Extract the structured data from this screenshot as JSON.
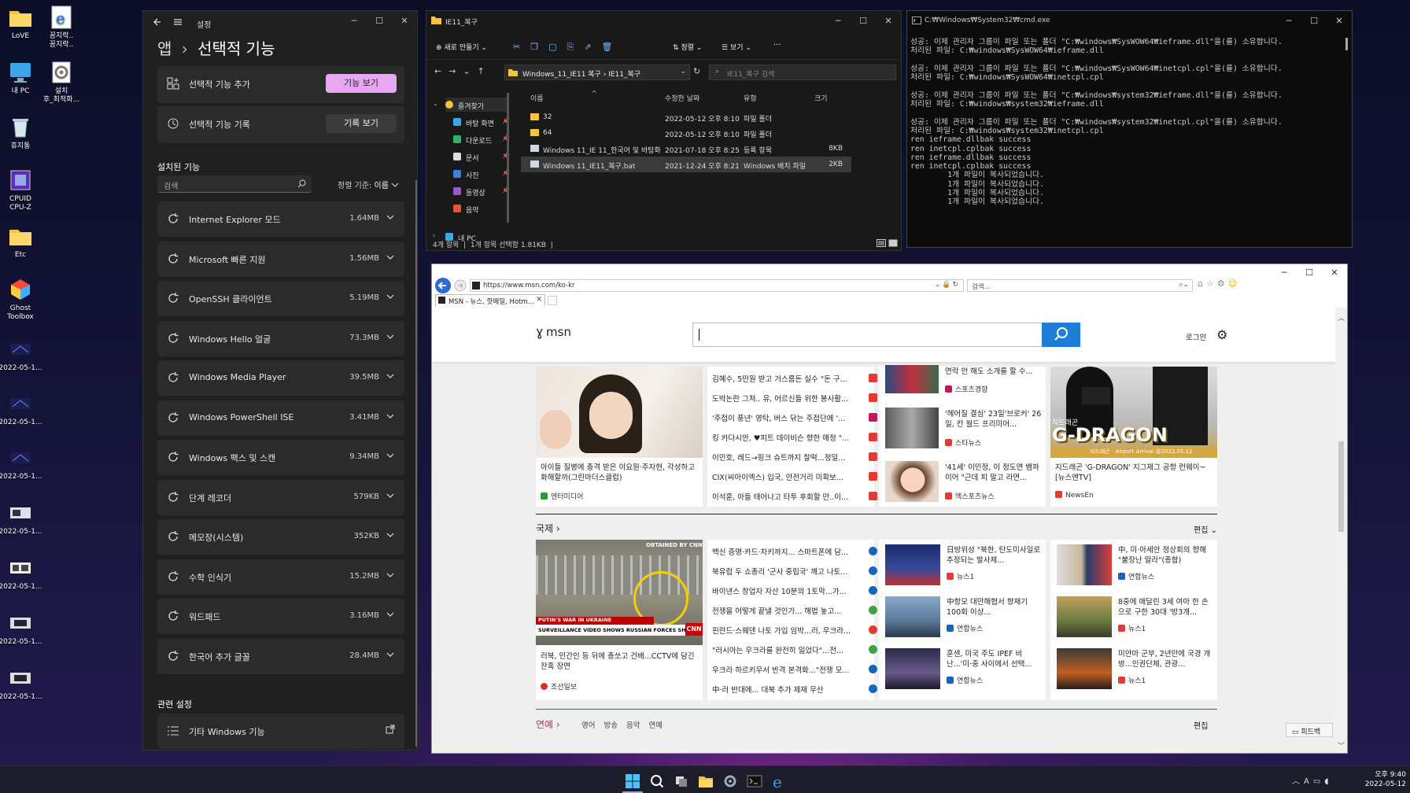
{
  "desktop": {
    "icons": [
      {
        "label": "LoVE"
      },
      {
        "label": "꽁지락..\n꽁지락.."
      },
      {
        "label": "내 PC"
      },
      {
        "label": "설치\n후_최적화..."
      },
      {
        "label": "휴지통"
      },
      {
        "label": "CPUID\nCPU-Z"
      },
      {
        "label": "Etc"
      },
      {
        "label": "Ghost\nToolbox"
      },
      {
        "label": "2022-05-1..."
      },
      {
        "label": "2022-05-1..."
      },
      {
        "label": "2022-05-1..."
      },
      {
        "label": "2022-05-1..."
      },
      {
        "label": "2022-05-1..."
      },
      {
        "label": "2022-05-1..."
      },
      {
        "label": "2022-05-1..."
      }
    ]
  },
  "settings": {
    "title": "설정",
    "breadcrumb_parent": "앱",
    "breadcrumb_sep": "›",
    "page_title": "선택적 기능",
    "add_feature_label": "선택적 기능 추가",
    "view_features_btn": "기능 보기",
    "history_label": "선택적 기능 기록",
    "view_history_btn": "기록 보기",
    "installed_heading": "설치된 기능",
    "search_placeholder": "검색",
    "sort_label": "정렬 기준:",
    "sort_value": "이름",
    "features": [
      {
        "name": "Internet Explorer 모드",
        "size": "1.64MB"
      },
      {
        "name": "Microsoft 빠른 지원",
        "size": "1.56MB"
      },
      {
        "name": "OpenSSH 클라이언트",
        "size": "5.19MB"
      },
      {
        "name": "Windows Hello 얼굴",
        "size": "73.3MB"
      },
      {
        "name": "Windows Media Player",
        "size": "39.5MB"
      },
      {
        "name": "Windows PowerShell ISE",
        "size": "3.41MB"
      },
      {
        "name": "Windows 팩스 및 스캔",
        "size": "9.34MB"
      },
      {
        "name": "단계 레코더",
        "size": "579KB"
      },
      {
        "name": "메모장(시스템)",
        "size": "352KB"
      },
      {
        "name": "수학 인식기",
        "size": "15.2MB"
      },
      {
        "name": "워드패드",
        "size": "3.16MB"
      },
      {
        "name": "한국어 추가 글꼴",
        "size": "28.4MB"
      }
    ],
    "related_heading": "관련 설정",
    "other_features": "기타 Windows 기능"
  },
  "explorer": {
    "title": "IE11_복구",
    "new_btn": "새로 만들기",
    "sort_btn": "정렬",
    "view_btn": "보기",
    "more_btn": "···",
    "path_seg1": "Windows_11_IE11 복구",
    "path_sep": "›",
    "path_seg2": "IE11_복구",
    "search_placeholder": "IE11_복구 검색",
    "columns": {
      "name": "이름",
      "date": "수정한 날짜",
      "type": "유형",
      "size": "크기"
    },
    "nav": [
      {
        "label": "즐겨찾기"
      },
      {
        "label": "바탕 화면"
      },
      {
        "label": "다운로드"
      },
      {
        "label": "문서"
      },
      {
        "label": "사진"
      },
      {
        "label": "동영상"
      },
      {
        "label": "음악"
      },
      {
        "label": "내 PC"
      }
    ],
    "files": [
      {
        "name": "32",
        "date": "2022-05-12 오후 8:10",
        "type": "파일 폴더",
        "size": ""
      },
      {
        "name": "64",
        "date": "2022-05-12 오후 8:10",
        "type": "파일 폴더",
        "size": ""
      },
      {
        "name": "Windows 11_IE 11_한국어 및 바탕화면 ...",
        "date": "2021-07-18 오후 8:25",
        "type": "등록 항목",
        "size": "8KB"
      },
      {
        "name": "Windows 11_IE11_복구.bat",
        "date": "2021-12-24 오후 8:21",
        "type": "Windows 배치 파일",
        "size": "2KB"
      }
    ],
    "status": "4개 항목  |  1개 항목 선택함 1.81KB  |"
  },
  "cmd": {
    "title": "C:₩Windows₩System32₩cmd.exe",
    "text": "성공: 이제 관리자 그룹이 파일 또는 폴더 \"C:₩windows₩SysWOW64₩ieframe.dll\"을(를) 소유합니다.\n처리된 파일: C:₩windows₩SysWOW64₩ieframe.dll\n\n성공: 이제 관리자 그룹이 파일 또는 폴더 \"C:₩windows₩SysWOW64₩inetcpl.cpl\"을(를) 소유합니다.\n처리된 파일: C:₩windows₩SysWOW64₩inetcpl.cpl\n\n성공: 이제 관리자 그룹이 파일 또는 폴더 \"C:₩windows₩system32₩ieframe.dll\"을(를) 소유합니다.\n처리된 파일: C:₩windows₩system32₩ieframe.dll\n\n성공: 이제 관리자 그룹이 파일 또는 폴더 \"C:₩windows₩system32₩inetcpl.cpl\"을(를) 소유합니다.\n처리된 파일: C:₩windows₩system32₩inetcpl.cpl\nren ieframe.dllbak success\nren inetcpl.cplbak success\nren ieframe.dllbak success\nren inetcpl.cplbak success\n        1개 파일이 복사되었습니다.\n        1개 파일이 복사되었습니다.\n        1개 파일이 복사되었습니다.\n        1개 파일이 복사되었습니다."
  },
  "ie": {
    "url": "https://www.msn.com/ko-kr",
    "search_placeholder": "검색...",
    "tab_title": "MSN - 뉴스, 핫메일, Hotm...",
    "brand": "msn",
    "login": "로그인",
    "feedback": "피드백",
    "top": {
      "headline": "아이들 질병에 충격 받은 이요원·주자현, 각성하고 화해할까(그린마더스클럽)",
      "source": "엔터미디어",
      "mid_items": [
        {
          "text": "김혜수, 5만원 받고 거스름돈 실수 \"돈 구..."
        },
        {
          "text": "도박논란 그쳐.. 유, 어르신들 위한 봉사활..."
        },
        {
          "text": "'주접이 풍년' 영탁, 버스 닦는 주접단에 '..."
        },
        {
          "text": "킹 카다시안, ♥피트 데이비슨 향한 애정 \"..."
        },
        {
          "text": "이민호, 레드→핑크 슈트까지 찰떡...정일..."
        },
        {
          "text": "CIX(씨아이엑스) 입국, 안전거리 미확보..."
        },
        {
          "text": "이석훈, 아들 태어나고 타투 후회할 만..이..."
        }
      ],
      "thumbs": [
        {
          "title": "연락 안 해도 소개를 할 수...",
          "source": "스포츠경향"
        },
        {
          "title": "'헤어질 결심' 23일'브로커' 26일, 칸 월드 프리미어...",
          "source": "스타뉴스"
        },
        {
          "title": "'41세' 이민정, 이 정도면 뱀파이어 \"근데 피 말고 라면...",
          "source": "엑스포츠뉴스"
        }
      ],
      "gdragon_title": "지드래곤 'G-DRAGON' 지그재그 공항 런웨이~ [뉴스엔TV]",
      "gdragon_source": "NewsEn"
    },
    "world": {
      "section": "국제",
      "edit": "편집",
      "headline": "러북, 민간인 등 뒤에 총쏘고 건배...CCTV에 담긴 잔혹 장면",
      "source": "조선일보",
      "mid_items": [
        {
          "text": "백신 증명·카드·차키까지... 스마트폰에 담..."
        },
        {
          "text": "북유럽 두 쇼총리 '군사 중립국' 깨고 나토..."
        },
        {
          "text": "바이낸스 창업자 자산 10분의 1토막...가..."
        },
        {
          "text": "전쟁을 어떻게 끝낼 것인가... 해법 놓고..."
        },
        {
          "text": "핀란드·스웨덴 나토 가입 임박...러, 우크라..."
        },
        {
          "text": "\"러시아는 우크라를 완전히 잃었다\"...전..."
        },
        {
          "text": "우크라 하르키우서 반격 본격화...\"전쟁 모..."
        },
        {
          "text": "中·러 반대에... 대북 추가 제재 무산"
        }
      ],
      "col3": [
        {
          "title": "日방위성 \"북한, 탄도미사일로 추정되는 발사체...",
          "source": "뉴스1"
        },
        {
          "title": "中항모 대만해협서 항재기 100회 이상...",
          "source": "연합뉴스"
        },
        {
          "title": "훈센, 미국 주도 IPEF 비난...'미·중 사이에서 선택...",
          "source": "연합뉴스"
        }
      ],
      "col4": [
        {
          "title": "中, 미·아세안 정상회의 향해 \"불장난 말라\"(종합)",
          "source": "연합뉴스"
        },
        {
          "title": "8중에 매달린 3세 여아 한 손으로 구한 30대 '방3개...",
          "source": "뉴스1"
        },
        {
          "title": "미얀마 군부, 2년만에 국경 개방...인권단체, 관광...",
          "source": "뉴스1"
        }
      ]
    },
    "image_caption": {
      "top": "OBTAINED BY CNN",
      "band1": "PUTIN'S WAR IN UKRAINE",
      "band2": "SURVEILLANCE VIDEO SHOWS RUSSIAN FORCES SHOOTING CIVILIANS",
      "cnn": "CNN",
      "gd_big": "G-DRAGON",
      "gd_small": "지드래곤 · Airport Arrival @2022.05.12",
      "gd_side": "지드래곤"
    },
    "next_tabs": {
      "t0": "연예",
      "t1": "영어",
      "t2": "방송",
      "t3": "음악",
      "t4": "연예",
      "t5": "편집"
    }
  },
  "taskbar": {
    "time": "오후 9:40",
    "date": "2022-05-12",
    "ime": "A"
  }
}
